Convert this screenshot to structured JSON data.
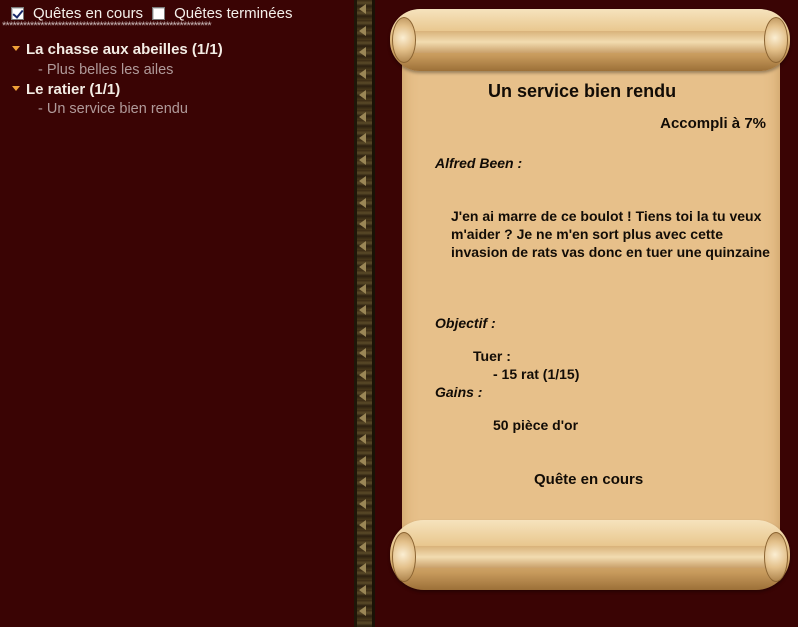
{
  "filters": {
    "in_progress_label": "Quêtes en cours",
    "in_progress_checked": true,
    "finished_label": "Quêtes terminées",
    "finished_checked": false
  },
  "separator": "************************************************************",
  "quest_list": [
    {
      "title": "La chasse aux abeilles (1/1)",
      "subquests": [
        "- Plus belles les ailes"
      ]
    },
    {
      "title": "Le ratier (1/1)",
      "subquests": [
        "- Un service bien rendu"
      ]
    }
  ],
  "quest_detail": {
    "title": "Un service bien rendu",
    "progress": "Accompli à 7%",
    "npc": "Alfred Been :",
    "description": "J'en ai marre de ce boulot ! Tiens toi la tu veux m'aider ? Je ne m'en sort plus avec cette invasion de rats vas donc en tuer une quinzaine",
    "objective_label": "Objectif :",
    "kill_label": "Tuer :",
    "kill_item": "- 15 rat (1/15)",
    "gains_label": "Gains :",
    "gold": "50 pièce d'or",
    "status": "Quête en cours"
  },
  "colors": {
    "background": "#3a0404",
    "paper": "#e7c08a",
    "arrow": "#f0a23a"
  }
}
